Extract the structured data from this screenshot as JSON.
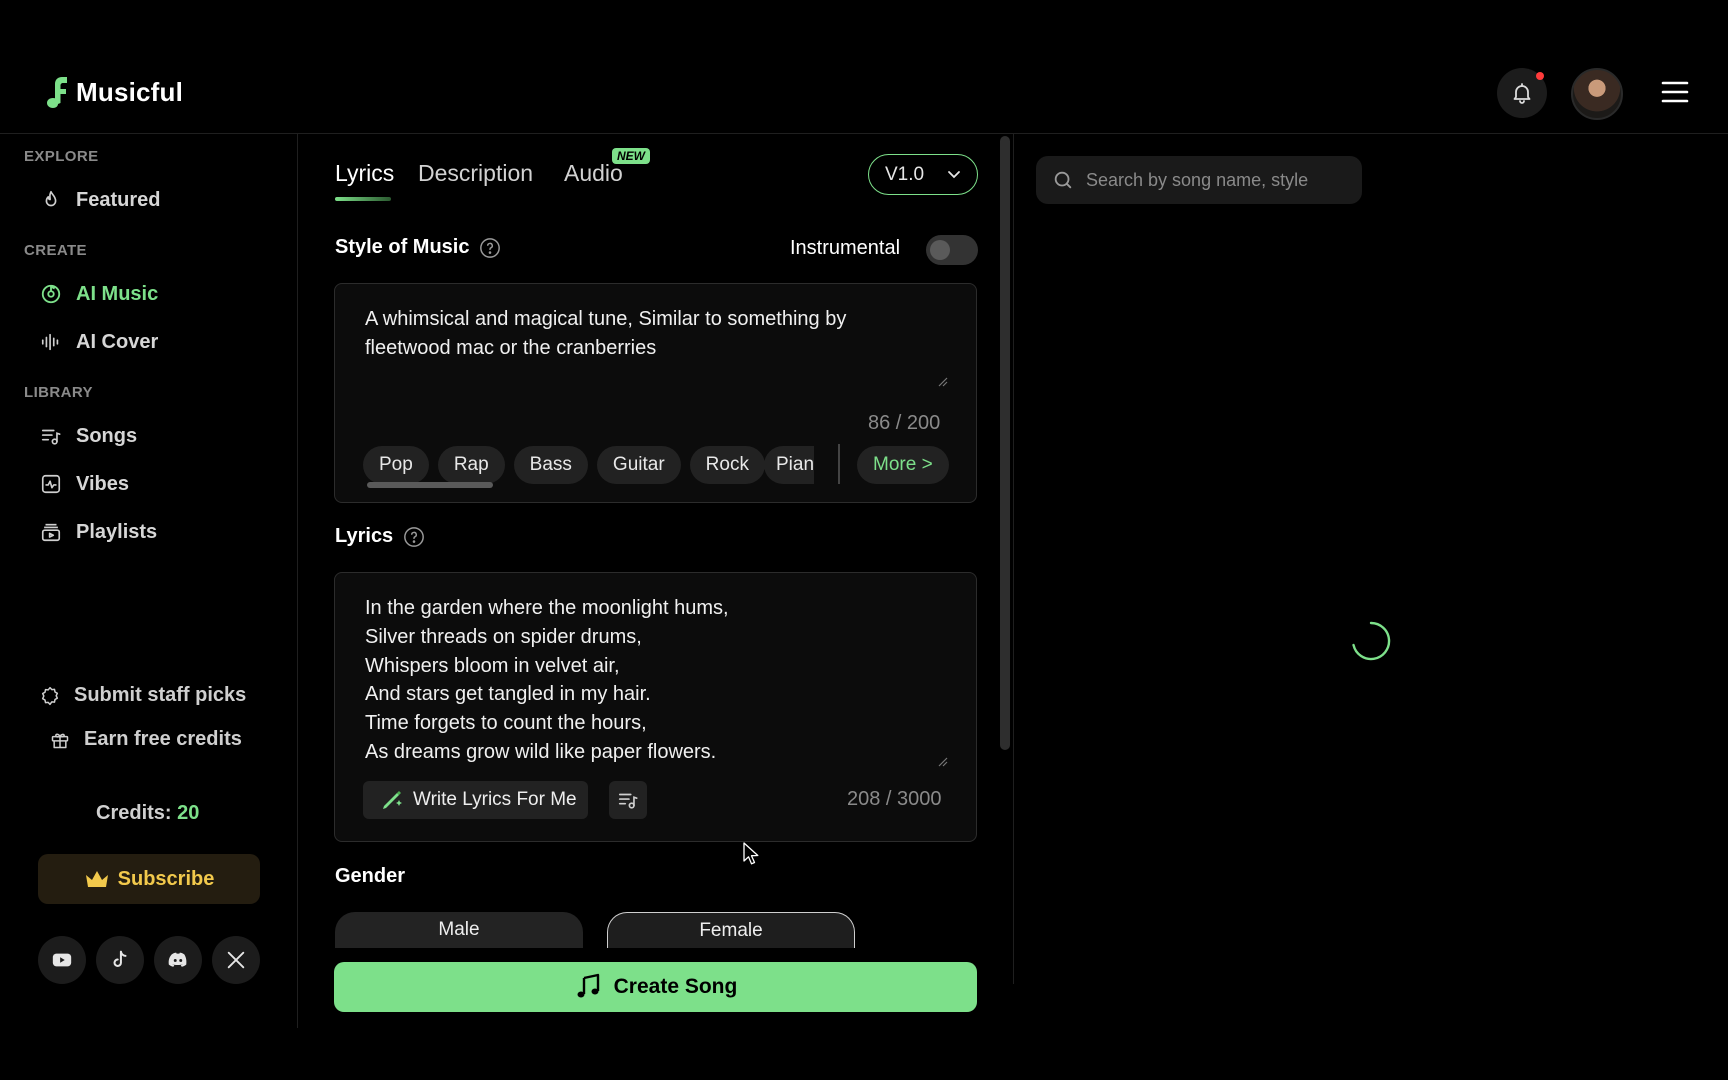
{
  "app": {
    "name": "Musicful",
    "brand_color": "#7de08a"
  },
  "sidebar": {
    "sections": {
      "explore": "EXPLORE",
      "create": "CREATE",
      "library": "LIBRARY"
    },
    "items": [
      {
        "label": "Featured",
        "icon": "flame-icon"
      },
      {
        "label": "AI Music",
        "icon": "ai-music-icon",
        "active": true
      },
      {
        "label": "AI Cover",
        "icon": "waveform-icon"
      },
      {
        "label": "Songs",
        "icon": "song-list-icon"
      },
      {
        "label": "Vibes",
        "icon": "vibes-icon"
      },
      {
        "label": "Playlists",
        "icon": "playlist-icon"
      }
    ],
    "submit_staff_picks": "Submit staff picks",
    "earn_free_credits": "Earn free credits",
    "credits_label": "Credits:",
    "credits_value": "20",
    "subscribe_label": "Subscribe",
    "socials": [
      "youtube-icon",
      "tiktok-icon",
      "discord-icon",
      "x-icon"
    ]
  },
  "main": {
    "tabs": [
      {
        "label": "Lyrics",
        "active": true
      },
      {
        "label": "Description"
      },
      {
        "label": "Audio",
        "badge": "NEW"
      }
    ],
    "version": "V1.0",
    "style_title": "Style of Music",
    "instrumental_label": "Instrumental",
    "instrumental_on": false,
    "style_text": "A whimsical and magical tune, Similar to something by\nfleetwood mac or the cranberries",
    "style_counter": "86 / 200",
    "chips": [
      "Pop",
      "Rap",
      "Bass",
      "Guitar",
      "Rock"
    ],
    "chip_partial": "Pian",
    "more_label": "More >",
    "lyrics_title": "Lyrics",
    "lyrics_text": "In the garden where the moonlight hums,\nSilver threads on spider drums,\nWhispers bloom in velvet air,\nAnd stars get tangled in my hair.\nTime forgets to count the hours,\nAs dreams grow wild like paper flowers.",
    "write_lyrics_label": "Write Lyrics For Me",
    "lyrics_counter": "208 / 3000",
    "gender_title": "Gender",
    "gender_options": [
      "Male",
      "Female"
    ],
    "gender_selected": "Female",
    "create_label": "Create Song"
  },
  "right": {
    "search_placeholder": "Search by song name, style"
  }
}
